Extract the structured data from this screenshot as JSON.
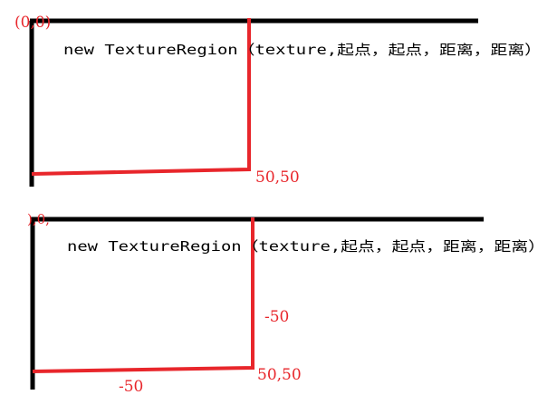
{
  "diagram_top": {
    "origin_label": "(0,0)",
    "code_text": "new TextureRegion（texture,起点，起点，距离，距离）",
    "corner_label": "50,50"
  },
  "diagram_bottom": {
    "origin_label": "),0,",
    "code_text": "new TextureRegion（texture,起点，起点，距离，距离）",
    "vertical_label": "-50",
    "horizontal_label": "-50",
    "corner_label": "50,50"
  },
  "colors": {
    "axis": "#000000",
    "region": "#e8262b",
    "label": "#e8262b"
  }
}
